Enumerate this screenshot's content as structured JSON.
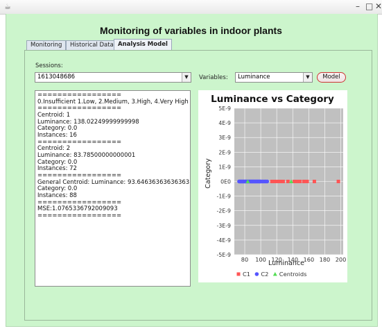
{
  "window": {
    "controls": [
      "–",
      "□",
      "✕"
    ]
  },
  "app": {
    "title": "Monitoring of variables in indoor plants",
    "tabs": [
      {
        "label": "Monitoring",
        "active": false
      },
      {
        "label": "Historical Data",
        "active": false
      },
      {
        "label": "Analysis Model",
        "active": true
      }
    ]
  },
  "form": {
    "sessions_label": "Sessions:",
    "session_value": "1613048686",
    "variables_label": "Variables:",
    "variable_value": "Luminance",
    "model_button": "Model"
  },
  "output_lines": [
    "=================",
    "0.Insufficient 1.Low, 2.Medium, 3.High, 4.Very High",
    "=================",
    "Centroid: 1",
    "Luminance: 138.02249999999998",
    "Category: 0.0",
    "Instances: 16",
    "=================",
    "Centroid: 2",
    "Luminance: 83.78500000000001",
    "Category: 0.0",
    "Instances: 72",
    "=================",
    "General Centroid: Luminance: 93.64636363636363",
    "Category: 0.0",
    "Instances: 88",
    "=================",
    "MSE:1.0765336792009093",
    "================="
  ],
  "chart_data": {
    "type": "scatter",
    "title": "Luminance vs Category",
    "xlabel": "Luminance",
    "ylabel": "Category",
    "xlim": [
      67,
      203
    ],
    "ylim": [
      -5e-09,
      5e-09
    ],
    "x_ticks": [
      "80",
      "100",
      "120",
      "140",
      "160",
      "180",
      "200"
    ],
    "x_tick_values": [
      80,
      100,
      120,
      140,
      160,
      180,
      200
    ],
    "y_ticks": [
      "5E-9",
      "4E-9",
      "3E-9",
      "2E-9",
      "1E-9",
      "0E0",
      "-1E-9",
      "-2E-9",
      "-3E-9",
      "-4E-9",
      "-5E-9"
    ],
    "y_tick_values": [
      5e-09,
      4e-09,
      3e-09,
      2e-09,
      1e-09,
      0,
      -1e-09,
      -2e-09,
      -3e-09,
      -4e-09,
      -5e-09
    ],
    "grid": true,
    "legend_position": "bottom",
    "series": [
      {
        "name": "C1",
        "color": "#ff5555",
        "marker": "square",
        "x": [
          114,
          116,
          118,
          120,
          121,
          123,
          125,
          128,
          134,
          142,
          145,
          149,
          154,
          158,
          167,
          197
        ],
        "y": [
          0,
          0,
          0,
          0,
          0,
          0,
          0,
          0,
          0,
          0,
          0,
          0,
          0,
          0,
          0,
          0
        ]
      },
      {
        "name": "C2",
        "color": "#5555ff",
        "marker": "circle",
        "x": [
          73,
          74,
          75,
          76,
          77,
          78,
          79,
          80,
          81,
          82,
          83,
          84,
          85,
          86,
          87,
          88,
          89,
          90,
          91,
          92,
          93,
          94,
          95,
          96,
          97,
          98,
          99,
          100,
          102,
          104,
          106,
          108
        ],
        "y": [
          0,
          0,
          0,
          0,
          0,
          0,
          0,
          0,
          0,
          0,
          0,
          0,
          0,
          0,
          0,
          0,
          0,
          0,
          0,
          0,
          0,
          0,
          0,
          0,
          0,
          0,
          0,
          0,
          0,
          0,
          0,
          0
        ]
      },
      {
        "name": "Centroids",
        "color": "#55dd55",
        "marker": "triangle",
        "x": [
          83.785,
          138.0225
        ],
        "y": [
          0,
          0
        ]
      }
    ]
  }
}
